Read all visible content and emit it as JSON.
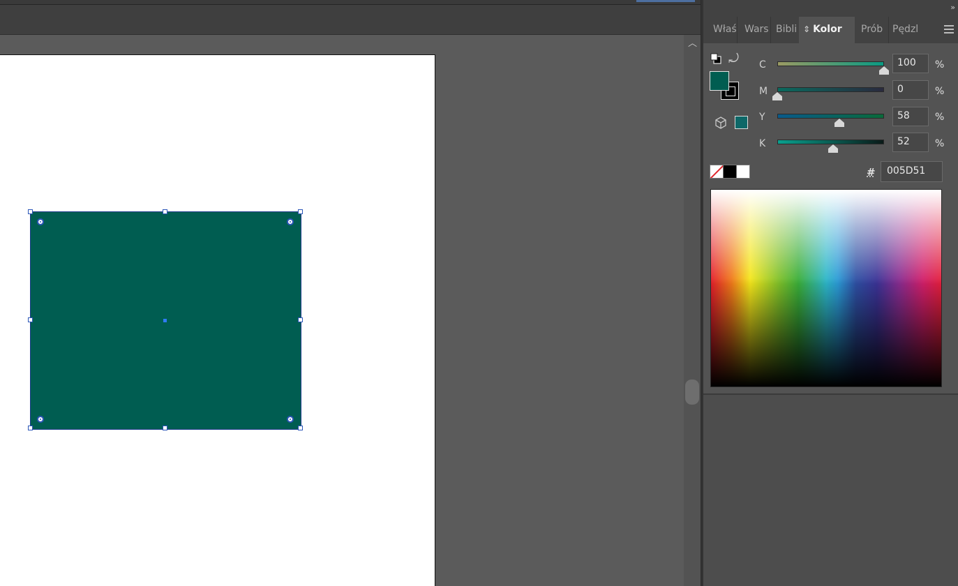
{
  "colors": {
    "fill": "#005D51",
    "shape": "#005D51",
    "gamut": "#0E6868"
  },
  "panel": {
    "tabs": [
      {
        "label": "Właś"
      },
      {
        "label": "Wars"
      },
      {
        "label": "Bibli"
      },
      {
        "label": "Kolor",
        "active": true
      },
      {
        "label": "Prób"
      },
      {
        "label": "Pędzl"
      }
    ],
    "collapse_icon": "double-chevron-right-icon",
    "menu_icon": "hamburger-menu-icon",
    "sort_icon": "⇕"
  },
  "color_panel": {
    "channels": [
      {
        "label": "C",
        "value": "100",
        "percent": 100,
        "unit": "%"
      },
      {
        "label": "M",
        "value": "0",
        "percent": 0,
        "unit": "%"
      },
      {
        "label": "Y",
        "value": "58",
        "percent": 58,
        "unit": "%"
      },
      {
        "label": "K",
        "value": "52",
        "percent": 52,
        "unit": "%"
      }
    ],
    "hash_label": "#",
    "hex_value": "005D51",
    "quick_swatches": [
      "none-swatch",
      "black-swatch",
      "white-swatch"
    ]
  }
}
